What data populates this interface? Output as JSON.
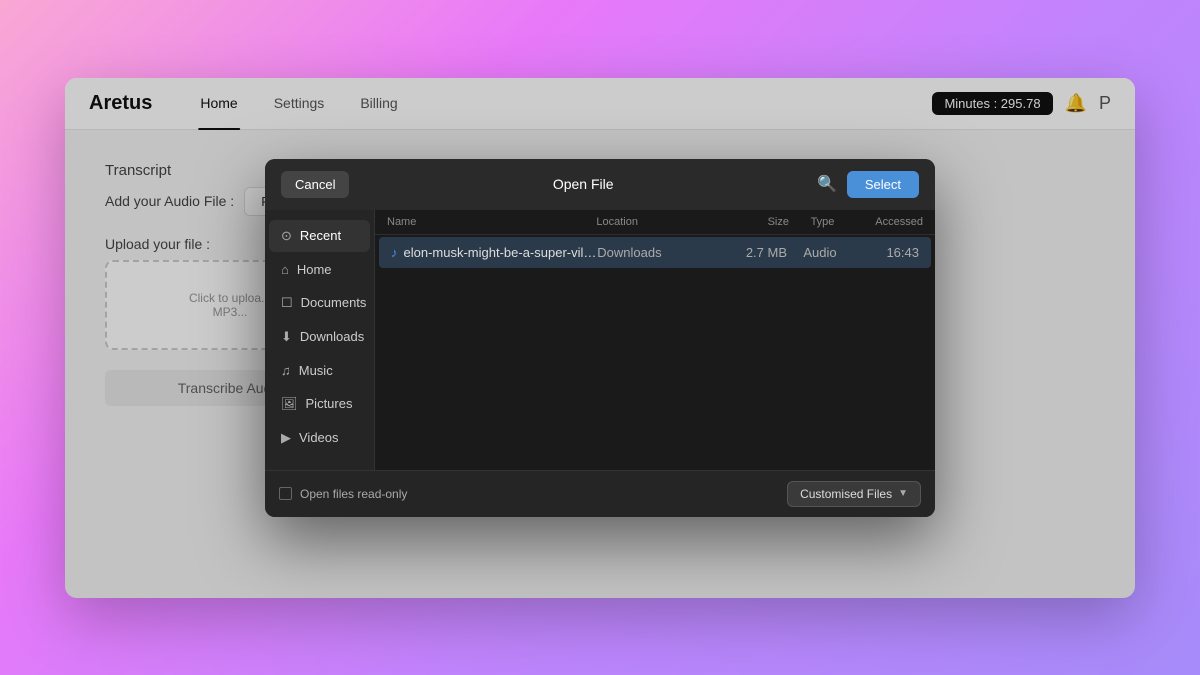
{
  "app": {
    "logo": "Aretus",
    "minutes_badge": "Minutes : 295.78",
    "nav_tabs": [
      {
        "label": "Home",
        "active": true
      },
      {
        "label": "Settings",
        "active": false
      },
      {
        "label": "Billing",
        "active": false
      }
    ]
  },
  "main_content": {
    "transcript_label": "Transcript",
    "add_audio_label": "Add your Audio File :",
    "from_file_btn": "From File",
    "upload_label": "Upload your file :",
    "upload_hint_line1": "Click to uploa...",
    "upload_hint_line2": "MP3...",
    "transcribe_btn": "Transcribe Audio"
  },
  "modal": {
    "title": "Open File",
    "cancel_btn": "Cancel",
    "select_btn": "Select",
    "sidebar_items": [
      {
        "label": "Recent",
        "icon": "⊙",
        "active": true
      },
      {
        "label": "Home",
        "icon": "⌂",
        "active": false
      },
      {
        "label": "Documents",
        "icon": "☐",
        "active": false
      },
      {
        "label": "Downloads",
        "icon": "⬇",
        "active": false
      },
      {
        "label": "Music",
        "icon": "♫",
        "active": false
      },
      {
        "label": "Pictures",
        "icon": "🖼",
        "active": false
      },
      {
        "label": "Videos",
        "icon": "▶",
        "active": false
      }
    ],
    "file_list_headers": {
      "name": "Name",
      "location": "Location",
      "size": "Size",
      "type": "Type",
      "accessed": "Accessed"
    },
    "files": [
      {
        "name": "elon-musk-might-be-a-super-villai...",
        "location": "Downloads",
        "size": "2.7 MB",
        "type": "Audio",
        "accessed": "16:43",
        "selected": true
      }
    ],
    "footer": {
      "read_only_label": "Open files read-only",
      "customised_files_btn": "Customised Files"
    }
  }
}
